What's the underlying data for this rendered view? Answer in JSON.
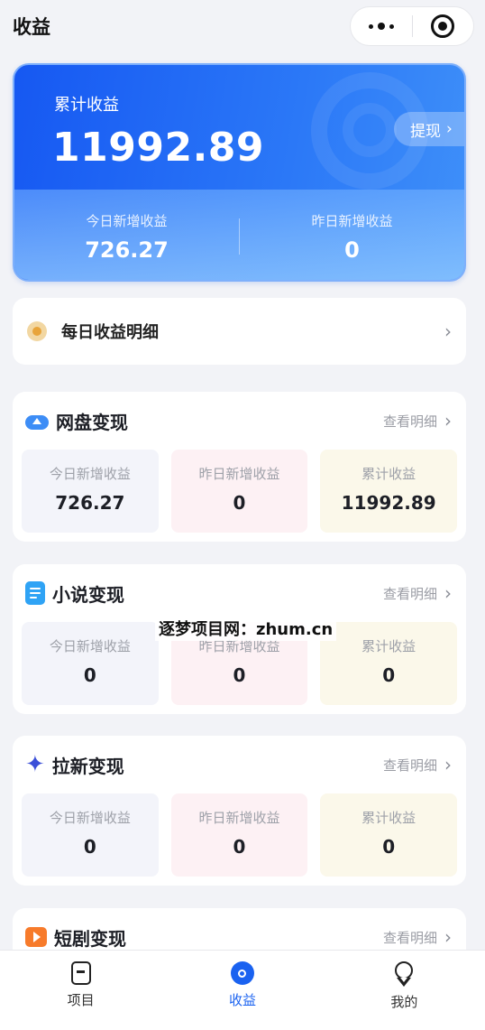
{
  "header": {
    "title": "收益"
  },
  "hero": {
    "label": "累计收益",
    "total": "11992.89",
    "withdraw_label": "提现",
    "today_label": "今日新增收益",
    "today_value": "726.27",
    "yesterday_label": "昨日新增收益",
    "yesterday_value": "0"
  },
  "daily": {
    "label": "每日收益明细"
  },
  "sections": [
    {
      "name": "网盘变现",
      "more": "查看明细",
      "icon": "cloud-icon",
      "stats": [
        {
          "label": "今日新增收益",
          "value": "726.27"
        },
        {
          "label": "昨日新增收益",
          "value": "0"
        },
        {
          "label": "累计收益",
          "value": "11992.89"
        }
      ]
    },
    {
      "name": "小说变现",
      "more": "查看明细",
      "icon": "book-icon",
      "stats": [
        {
          "label": "今日新增收益",
          "value": "0"
        },
        {
          "label": "昨日新增收益",
          "value": "0"
        },
        {
          "label": "累计收益",
          "value": "0"
        }
      ]
    },
    {
      "name": "拉新变现",
      "more": "查看明细",
      "icon": "sparkle-icon",
      "stats": [
        {
          "label": "今日新增收益",
          "value": "0"
        },
        {
          "label": "昨日新增收益",
          "value": "0"
        },
        {
          "label": "累计收益",
          "value": "0"
        }
      ]
    },
    {
      "name": "短剧变现",
      "more": "查看明细",
      "icon": "play-icon"
    }
  ],
  "watermark": "逐梦项目网：zhum.cn",
  "tabbar": {
    "items": [
      {
        "label": "项目",
        "active": false
      },
      {
        "label": "收益",
        "active": true
      },
      {
        "label": "我的",
        "active": false
      }
    ]
  },
  "colors": {
    "accent": "#1a62f0",
    "hero_start": "#1658f2",
    "hero_end": "#3f90f9"
  }
}
